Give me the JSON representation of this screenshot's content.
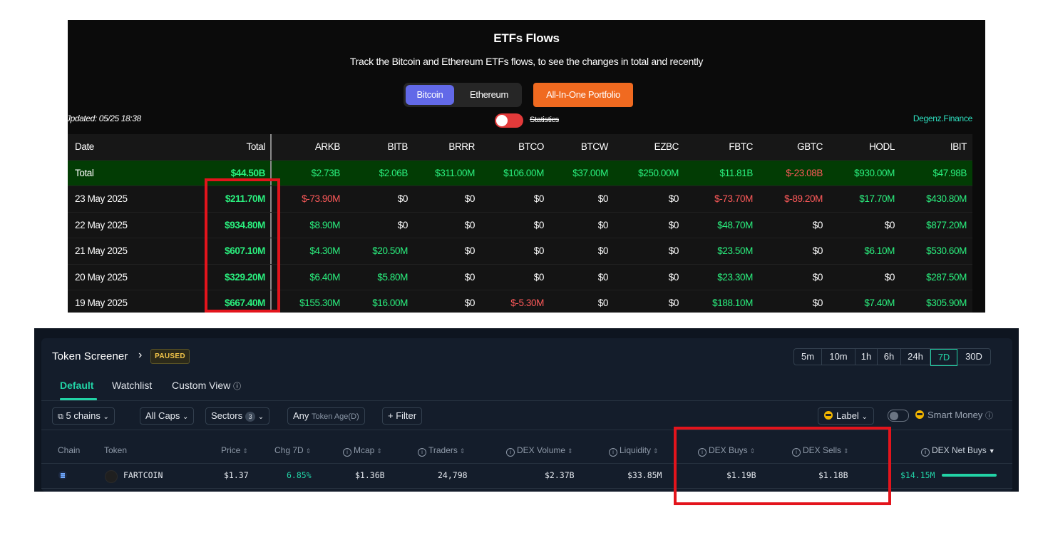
{
  "etf": {
    "title": "ETFs Flows",
    "subtitle": "Track the Bitcoin and Ethereum ETFs flows, to see the changes in total and recently",
    "tabs": [
      "Bitcoin",
      "Ethereum"
    ],
    "portfolio_button": "All-In-One Portfolio",
    "updated": "Jpdated: 05/25 18:38",
    "statistics_label": "Statistics",
    "brand": "Degenz.Finance",
    "colors": {
      "positive": "#2af07e",
      "negative": "#ff5a5a",
      "active_tab": "#6269e8",
      "portfolio": "#f06a20",
      "total_row": "#023c04"
    },
    "columns": [
      "Date",
      "Total",
      "ARKB",
      "BITB",
      "BRRR",
      "BTCO",
      "BTCW",
      "EZBC",
      "FBTC",
      "GBTC",
      "HODL",
      "IBIT"
    ],
    "rows": [
      [
        "Total",
        "$44.50B",
        "$2.73B",
        "$2.06B",
        "$311.00M",
        "$106.00M",
        "$37.00M",
        "$250.00M",
        "$11.81B",
        "$-23.08B",
        "$930.00M",
        "$47.98B"
      ],
      [
        "23 May 2025",
        "$211.70M",
        "$-73.90M",
        "$0",
        "$0",
        "$0",
        "$0",
        "$0",
        "$-73.70M",
        "$-89.20M",
        "$17.70M",
        "$430.80M"
      ],
      [
        "22 May 2025",
        "$934.80M",
        "$8.90M",
        "$0",
        "$0",
        "$0",
        "$0",
        "$0",
        "$48.70M",
        "$0",
        "$0",
        "$877.20M"
      ],
      [
        "21 May 2025",
        "$607.10M",
        "$4.30M",
        "$20.50M",
        "$0",
        "$0",
        "$0",
        "$0",
        "$23.50M",
        "$0",
        "$6.10M",
        "$530.60M"
      ],
      [
        "20 May 2025",
        "$329.20M",
        "$6.40M",
        "$5.80M",
        "$0",
        "$0",
        "$0",
        "$0",
        "$23.30M",
        "$0",
        "$0",
        "$287.50M"
      ],
      [
        "19 May 2025",
        "$667.40M",
        "$155.30M",
        "$16.00M",
        "$0",
        "$-5.30M",
        "$0",
        "$0",
        "$188.10M",
        "$0",
        "$7.40M",
        "$305.90M"
      ]
    ]
  },
  "screener": {
    "title": "Token Screener",
    "status": "PAUSED",
    "timeframes": [
      "5m",
      "10m",
      "1h",
      "6h",
      "24h",
      "7D",
      "30D"
    ],
    "active_timeframe": "7D",
    "tabs": [
      "Default",
      "Watchlist",
      "Custom View"
    ],
    "filters": {
      "chains": "5 chains",
      "caps": "All Caps",
      "sectors": "Sectors",
      "sectors_count": "3",
      "age_value": "Any",
      "age_label": "Token Age(D)",
      "filter": "+ Filter",
      "label": "Label",
      "smart_money": "Smart Money"
    },
    "columns": [
      "Chain",
      "Token",
      "Price",
      "Chg 7D",
      "Mcap",
      "Traders",
      "DEX Volume",
      "Liquidity",
      "DEX Buys",
      "DEX Sells",
      "DEX Net Buys"
    ],
    "row": {
      "token": "FARTCOIN",
      "price": "$1.37",
      "change": "6.85%",
      "mcap": "$1.36B",
      "traders": "24,798",
      "volume": "$2.37B",
      "liquidity": "$33.85M",
      "buys": "$1.19B",
      "sells": "$1.18B",
      "net_buys": "$14.15M"
    },
    "colors": {
      "accent": "#22d3a6",
      "paused": "#f4c64a",
      "highlight": "#e3141c"
    }
  }
}
